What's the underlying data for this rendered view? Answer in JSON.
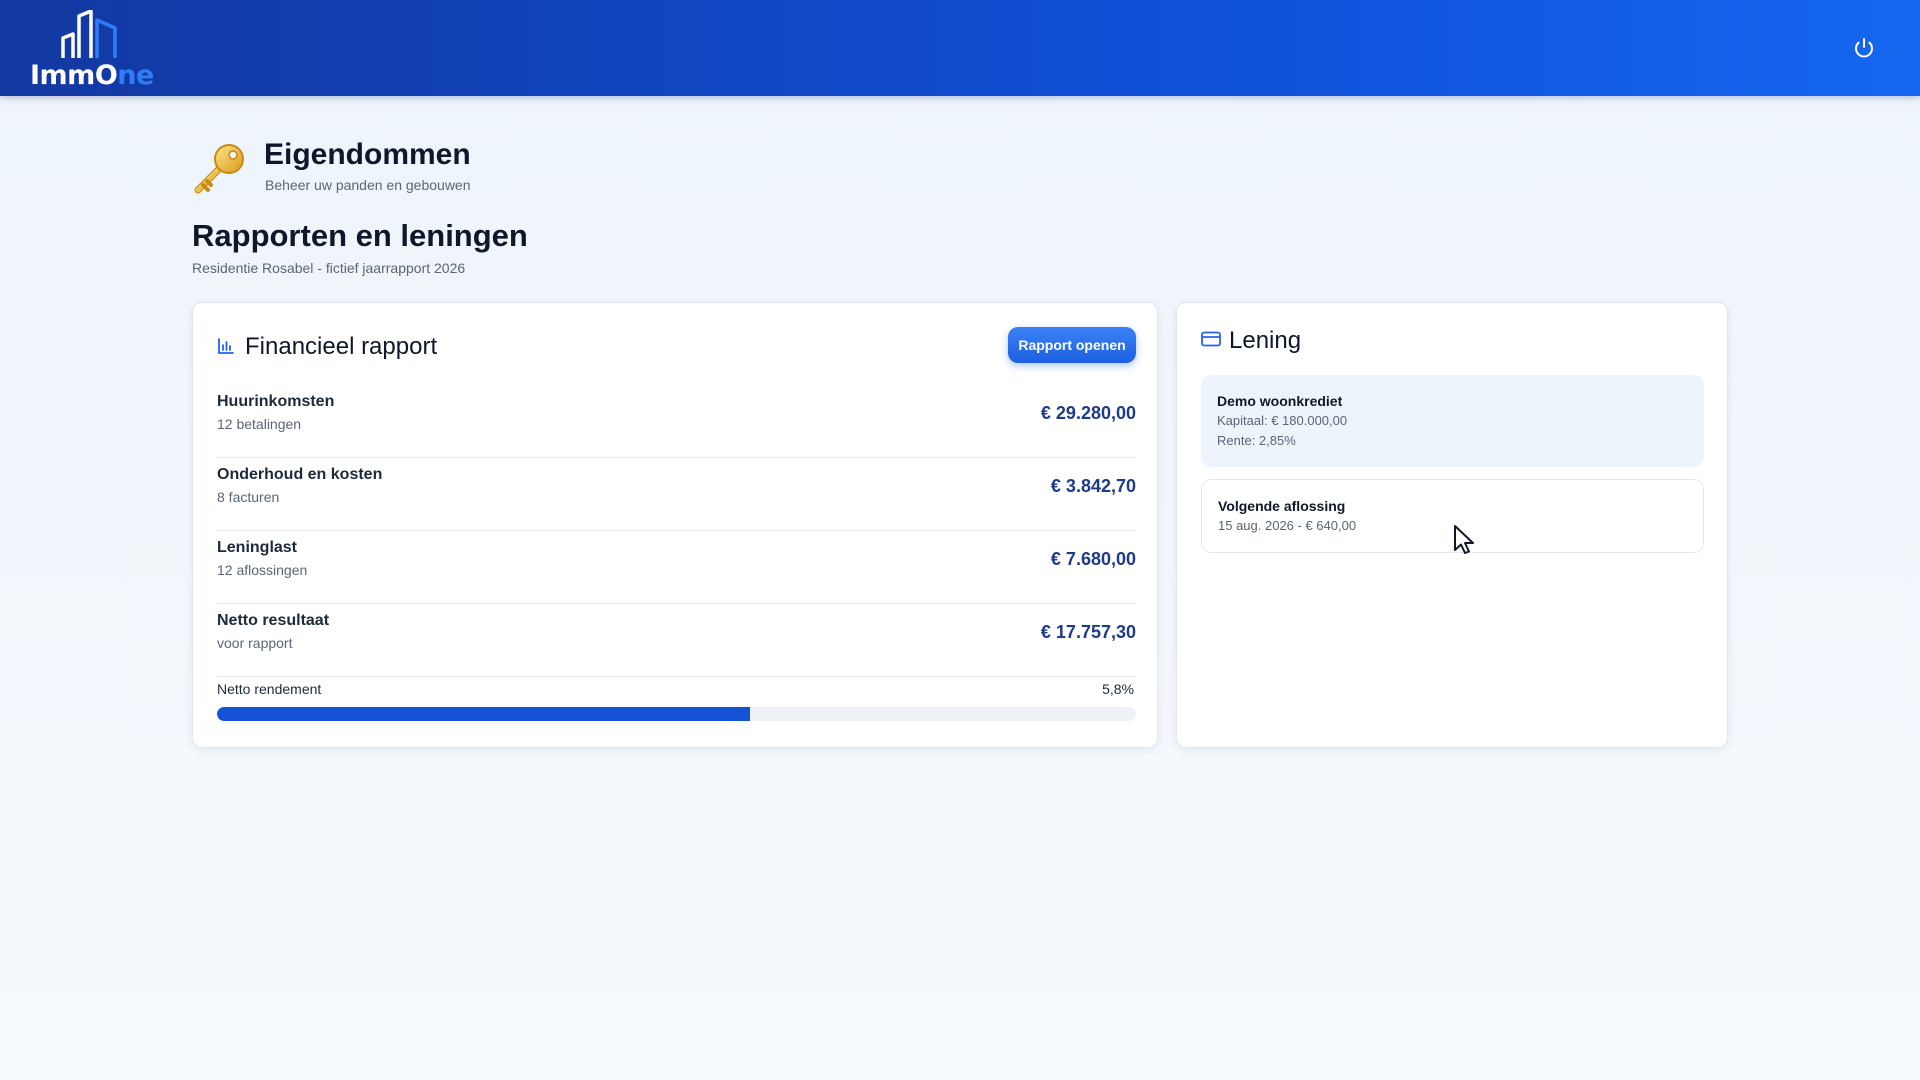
{
  "header": {
    "logo_part1": "ImmO",
    "logo_part2": "ne",
    "icons": {
      "logo": "buildings-icon",
      "logout": "power-icon"
    },
    "colors": {
      "gradient_start": "#1338a0",
      "gradient_end": "#1566f0",
      "logo_accent": "#2f7cf7"
    }
  },
  "page": {
    "icon": "key-icon",
    "title": "Eigendommen",
    "subtitle": "Beheer uw panden en gebouwen"
  },
  "section": {
    "title": "Rapporten en leningen",
    "subtitle": "Residentie Rosabel - fictief jaarrapport 2026"
  },
  "financial_report": {
    "icon": "bar-chart-icon",
    "title": "Financieel rapport",
    "open_button": "Rapport openen",
    "rows": [
      {
        "label": "Huurinkomsten",
        "sub": "12 betalingen",
        "amount": "€ 29.280,00"
      },
      {
        "label": "Onderhoud en kosten",
        "sub": "8 facturen",
        "amount": "€ 3.842,70"
      },
      {
        "label": "Leninglast",
        "sub": "12 aflossingen",
        "amount": "€ 7.680,00"
      },
      {
        "label": "Netto resultaat",
        "sub": "voor rapport",
        "amount": "€ 17.757,30"
      }
    ],
    "yield_label": "Netto rendement",
    "yield_value": "5,8%",
    "progress_fraction": 0.58,
    "colors": {
      "amount": "#1e3a8a",
      "progress": "#1453d6",
      "button": "#2563eb"
    }
  },
  "loan": {
    "icon": "credit-card-icon",
    "title": "Lening",
    "loan_name": "Demo woonkrediet",
    "capital": "Kapitaal: € 180.000,00",
    "rate": "Rente: 2,85%",
    "next_title": "Volgende aflossing",
    "next_detail": "15 aug. 2026 - € 640,00"
  }
}
